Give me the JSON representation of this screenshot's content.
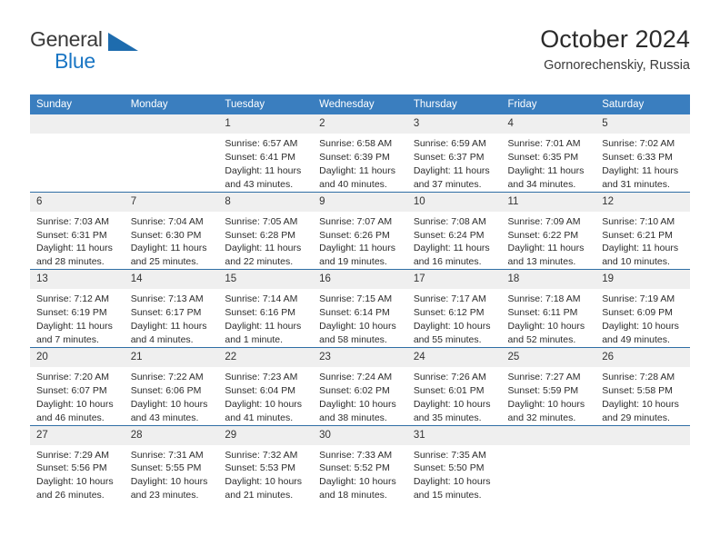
{
  "brand": {
    "name_top": "General",
    "name_bottom": "Blue",
    "accent_color": "#1a76c4",
    "triangle_color": "#1e6cae"
  },
  "header": {
    "title": "October 2024",
    "subtitle": "Gornorechenskiy, Russia"
  },
  "calendar": {
    "header_bg": "#3a7ebf",
    "row_divider_color": "#2f6ea5",
    "daynum_bg": "#efefef",
    "weekdays": [
      "Sunday",
      "Monday",
      "Tuesday",
      "Wednesday",
      "Thursday",
      "Friday",
      "Saturday"
    ],
    "labels": {
      "sunrise": "Sunrise:",
      "sunset": "Sunset:",
      "daylight": "Daylight:"
    },
    "weeks": [
      [
        {
          "day": "",
          "blank": true
        },
        {
          "day": "",
          "blank": true
        },
        {
          "day": "1",
          "sunrise": "Sunrise: 6:57 AM",
          "sunset": "Sunset: 6:41 PM",
          "daylight_1": "Daylight: 11 hours",
          "daylight_2": "and 43 minutes."
        },
        {
          "day": "2",
          "sunrise": "Sunrise: 6:58 AM",
          "sunset": "Sunset: 6:39 PM",
          "daylight_1": "Daylight: 11 hours",
          "daylight_2": "and 40 minutes."
        },
        {
          "day": "3",
          "sunrise": "Sunrise: 6:59 AM",
          "sunset": "Sunset: 6:37 PM",
          "daylight_1": "Daylight: 11 hours",
          "daylight_2": "and 37 minutes."
        },
        {
          "day": "4",
          "sunrise": "Sunrise: 7:01 AM",
          "sunset": "Sunset: 6:35 PM",
          "daylight_1": "Daylight: 11 hours",
          "daylight_2": "and 34 minutes."
        },
        {
          "day": "5",
          "sunrise": "Sunrise: 7:02 AM",
          "sunset": "Sunset: 6:33 PM",
          "daylight_1": "Daylight: 11 hours",
          "daylight_2": "and 31 minutes."
        }
      ],
      [
        {
          "day": "6",
          "sunrise": "Sunrise: 7:03 AM",
          "sunset": "Sunset: 6:31 PM",
          "daylight_1": "Daylight: 11 hours",
          "daylight_2": "and 28 minutes."
        },
        {
          "day": "7",
          "sunrise": "Sunrise: 7:04 AM",
          "sunset": "Sunset: 6:30 PM",
          "daylight_1": "Daylight: 11 hours",
          "daylight_2": "and 25 minutes."
        },
        {
          "day": "8",
          "sunrise": "Sunrise: 7:05 AM",
          "sunset": "Sunset: 6:28 PM",
          "daylight_1": "Daylight: 11 hours",
          "daylight_2": "and 22 minutes."
        },
        {
          "day": "9",
          "sunrise": "Sunrise: 7:07 AM",
          "sunset": "Sunset: 6:26 PM",
          "daylight_1": "Daylight: 11 hours",
          "daylight_2": "and 19 minutes."
        },
        {
          "day": "10",
          "sunrise": "Sunrise: 7:08 AM",
          "sunset": "Sunset: 6:24 PM",
          "daylight_1": "Daylight: 11 hours",
          "daylight_2": "and 16 minutes."
        },
        {
          "day": "11",
          "sunrise": "Sunrise: 7:09 AM",
          "sunset": "Sunset: 6:22 PM",
          "daylight_1": "Daylight: 11 hours",
          "daylight_2": "and 13 minutes."
        },
        {
          "day": "12",
          "sunrise": "Sunrise: 7:10 AM",
          "sunset": "Sunset: 6:21 PM",
          "daylight_1": "Daylight: 11 hours",
          "daylight_2": "and 10 minutes."
        }
      ],
      [
        {
          "day": "13",
          "sunrise": "Sunrise: 7:12 AM",
          "sunset": "Sunset: 6:19 PM",
          "daylight_1": "Daylight: 11 hours",
          "daylight_2": "and 7 minutes."
        },
        {
          "day": "14",
          "sunrise": "Sunrise: 7:13 AM",
          "sunset": "Sunset: 6:17 PM",
          "daylight_1": "Daylight: 11 hours",
          "daylight_2": "and 4 minutes."
        },
        {
          "day": "15",
          "sunrise": "Sunrise: 7:14 AM",
          "sunset": "Sunset: 6:16 PM",
          "daylight_1": "Daylight: 11 hours",
          "daylight_2": "and 1 minute."
        },
        {
          "day": "16",
          "sunrise": "Sunrise: 7:15 AM",
          "sunset": "Sunset: 6:14 PM",
          "daylight_1": "Daylight: 10 hours",
          "daylight_2": "and 58 minutes."
        },
        {
          "day": "17",
          "sunrise": "Sunrise: 7:17 AM",
          "sunset": "Sunset: 6:12 PM",
          "daylight_1": "Daylight: 10 hours",
          "daylight_2": "and 55 minutes."
        },
        {
          "day": "18",
          "sunrise": "Sunrise: 7:18 AM",
          "sunset": "Sunset: 6:11 PM",
          "daylight_1": "Daylight: 10 hours",
          "daylight_2": "and 52 minutes."
        },
        {
          "day": "19",
          "sunrise": "Sunrise: 7:19 AM",
          "sunset": "Sunset: 6:09 PM",
          "daylight_1": "Daylight: 10 hours",
          "daylight_2": "and 49 minutes."
        }
      ],
      [
        {
          "day": "20",
          "sunrise": "Sunrise: 7:20 AM",
          "sunset": "Sunset: 6:07 PM",
          "daylight_1": "Daylight: 10 hours",
          "daylight_2": "and 46 minutes."
        },
        {
          "day": "21",
          "sunrise": "Sunrise: 7:22 AM",
          "sunset": "Sunset: 6:06 PM",
          "daylight_1": "Daylight: 10 hours",
          "daylight_2": "and 43 minutes."
        },
        {
          "day": "22",
          "sunrise": "Sunrise: 7:23 AM",
          "sunset": "Sunset: 6:04 PM",
          "daylight_1": "Daylight: 10 hours",
          "daylight_2": "and 41 minutes."
        },
        {
          "day": "23",
          "sunrise": "Sunrise: 7:24 AM",
          "sunset": "Sunset: 6:02 PM",
          "daylight_1": "Daylight: 10 hours",
          "daylight_2": "and 38 minutes."
        },
        {
          "day": "24",
          "sunrise": "Sunrise: 7:26 AM",
          "sunset": "Sunset: 6:01 PM",
          "daylight_1": "Daylight: 10 hours",
          "daylight_2": "and 35 minutes."
        },
        {
          "day": "25",
          "sunrise": "Sunrise: 7:27 AM",
          "sunset": "Sunset: 5:59 PM",
          "daylight_1": "Daylight: 10 hours",
          "daylight_2": "and 32 minutes."
        },
        {
          "day": "26",
          "sunrise": "Sunrise: 7:28 AM",
          "sunset": "Sunset: 5:58 PM",
          "daylight_1": "Daylight: 10 hours",
          "daylight_2": "and 29 minutes."
        }
      ],
      [
        {
          "day": "27",
          "sunrise": "Sunrise: 7:29 AM",
          "sunset": "Sunset: 5:56 PM",
          "daylight_1": "Daylight: 10 hours",
          "daylight_2": "and 26 minutes."
        },
        {
          "day": "28",
          "sunrise": "Sunrise: 7:31 AM",
          "sunset": "Sunset: 5:55 PM",
          "daylight_1": "Daylight: 10 hours",
          "daylight_2": "and 23 minutes."
        },
        {
          "day": "29",
          "sunrise": "Sunrise: 7:32 AM",
          "sunset": "Sunset: 5:53 PM",
          "daylight_1": "Daylight: 10 hours",
          "daylight_2": "and 21 minutes."
        },
        {
          "day": "30",
          "sunrise": "Sunrise: 7:33 AM",
          "sunset": "Sunset: 5:52 PM",
          "daylight_1": "Daylight: 10 hours",
          "daylight_2": "and 18 minutes."
        },
        {
          "day": "31",
          "sunrise": "Sunrise: 7:35 AM",
          "sunset": "Sunset: 5:50 PM",
          "daylight_1": "Daylight: 10 hours",
          "daylight_2": "and 15 minutes."
        },
        {
          "day": "",
          "blank": true
        },
        {
          "day": "",
          "blank": true
        }
      ]
    ]
  }
}
